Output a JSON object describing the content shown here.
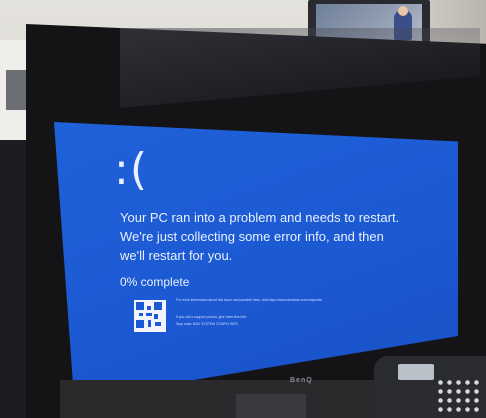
{
  "bsod": {
    "emoticon": ":(",
    "message": "Your PC ran into a problem and needs to restart. We're just collecting some error info, and then we'll restart for you.",
    "progress": "0% complete",
    "more_info": "For more information about this issue and possible fixes, visit https://www.windows.com/stopcode",
    "support_line": "If you call a support person, give them this info:",
    "stop_code": "Stop code: BAD SYSTEM CONFIG INFO"
  },
  "monitor": {
    "brand": "BenQ"
  },
  "colors": {
    "bsod_blue": "#1c5ad4",
    "bezel": "#141417"
  }
}
